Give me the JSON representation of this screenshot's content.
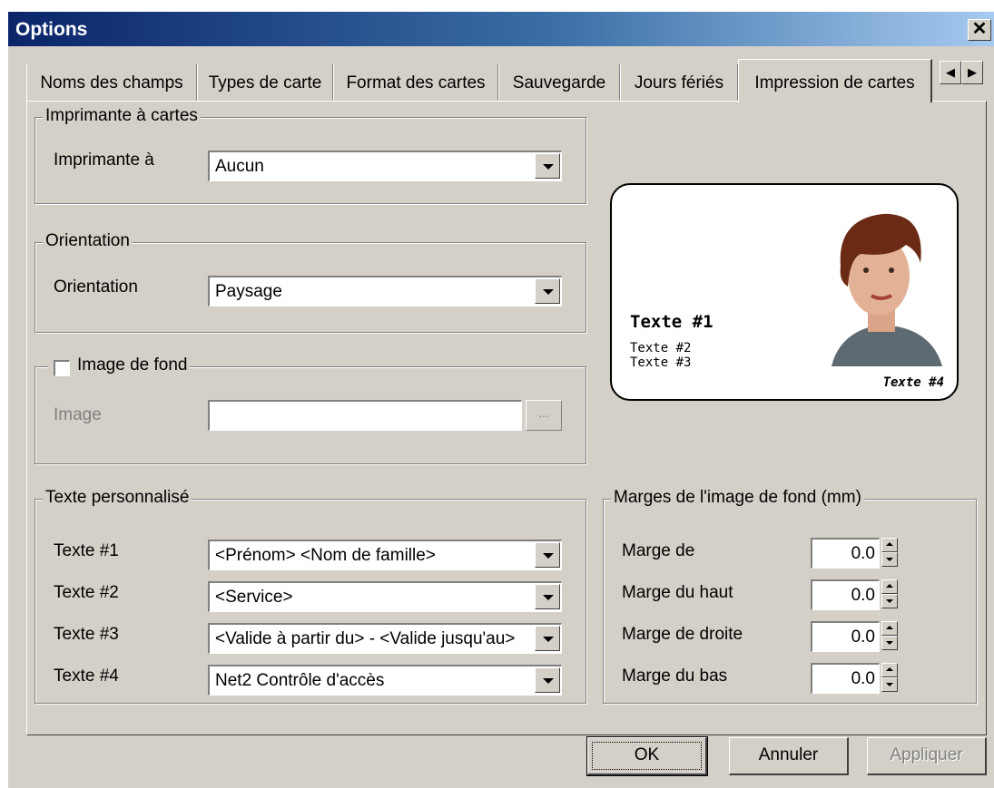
{
  "window": {
    "title": "Options"
  },
  "tabs": [
    {
      "label": "Noms des champs"
    },
    {
      "label": "Types de carte"
    },
    {
      "label": "Format des cartes"
    },
    {
      "label": "Sauvegarde"
    },
    {
      "label": "Jours fériés"
    },
    {
      "label": "Impression de cartes"
    }
  ],
  "printer_group": {
    "legend": "Imprimante à cartes",
    "label": "Imprimante à",
    "value": "Aucun"
  },
  "orientation_group": {
    "legend": "Orientation",
    "label": "Orientation",
    "value": "Paysage"
  },
  "background_group": {
    "legend": "Image de fond",
    "checked": false,
    "image_label": "Image",
    "image_value": "",
    "browse_label": "..."
  },
  "custom_text_group": {
    "legend": "Texte personnalisé",
    "rows": [
      {
        "label": "Texte #1",
        "value": "<Prénom> <Nom de famille>"
      },
      {
        "label": "Texte #2",
        "value": "<Service>"
      },
      {
        "label": "Texte #3",
        "value": "<Valide à partir du> - <Valide jusqu'au>"
      },
      {
        "label": "Texte #4",
        "value": "Net2 Contrôle d'accès"
      }
    ]
  },
  "margins_group": {
    "legend": "Marges de l'image de fond (mm)",
    "rows": [
      {
        "label": "Marge de",
        "value": "0.0"
      },
      {
        "label": "Marge du haut",
        "value": "0.0"
      },
      {
        "label": "Marge de droite",
        "value": "0.0"
      },
      {
        "label": "Marge du bas",
        "value": "0.0"
      }
    ]
  },
  "card_preview": {
    "text1": "Texte #1",
    "text2": "Texte #2",
    "text3": "Texte #3",
    "text4": "Texte #4"
  },
  "buttons": {
    "ok": "OK",
    "cancel": "Annuler",
    "apply": "Appliquer"
  }
}
